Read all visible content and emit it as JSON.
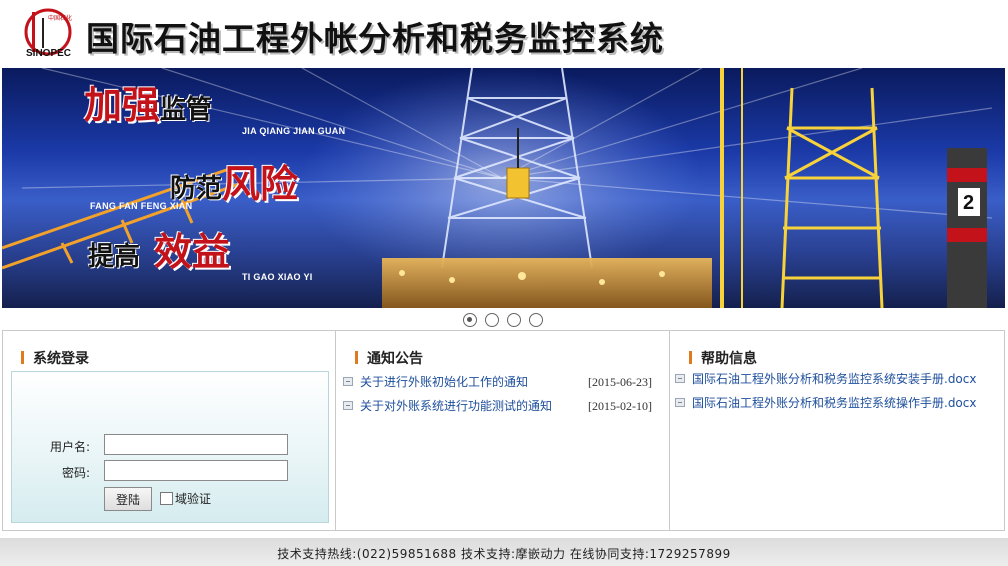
{
  "header": {
    "logo_text": "SINOPEC",
    "title": "国际石油工程外帐分析和税务监控系统"
  },
  "banner": {
    "slogans": [
      {
        "big": "加强",
        "small": "监管",
        "pinyin": "JIA QIANG JIAN GUAN"
      },
      {
        "small": "防范",
        "big": "风险",
        "pinyin": "FANG FAN FENG XIAN"
      },
      {
        "small": "提高",
        "big": "效益",
        "pinyin": "TI GAO XIAO YI"
      }
    ],
    "tower_number": "2"
  },
  "slider": {
    "dot_count": 4,
    "active_index": 0
  },
  "login": {
    "title": "系统登录",
    "username_label": "用户名:",
    "username_value": "",
    "password_label": "密码:",
    "password_value": "",
    "submit_label": "登陆",
    "domain_label": "域验证",
    "domain_checked": false
  },
  "notices": {
    "title": "通知公告",
    "items": [
      {
        "text": "关于进行外账初始化工作的通知",
        "date": "[2015-06-23]"
      },
      {
        "text": "关于对外账系统进行功能测试的通知",
        "date": "[2015-02-10]"
      }
    ]
  },
  "help": {
    "title": "帮助信息",
    "items": [
      {
        "text": "国际石油工程外账分析和税务监控系统安装手册.docx"
      },
      {
        "text": "国际石油工程外账分析和税务监控系统操作手册.docx"
      }
    ]
  },
  "footer": {
    "text": "技术支持热线:(022)59851688 技术支持:摩嵌动力 在线协同支持:1729257899"
  },
  "colors": {
    "accent_bar": "#e07a1e",
    "link": "#1d4e9c",
    "slogan_red": "#c4121a"
  }
}
